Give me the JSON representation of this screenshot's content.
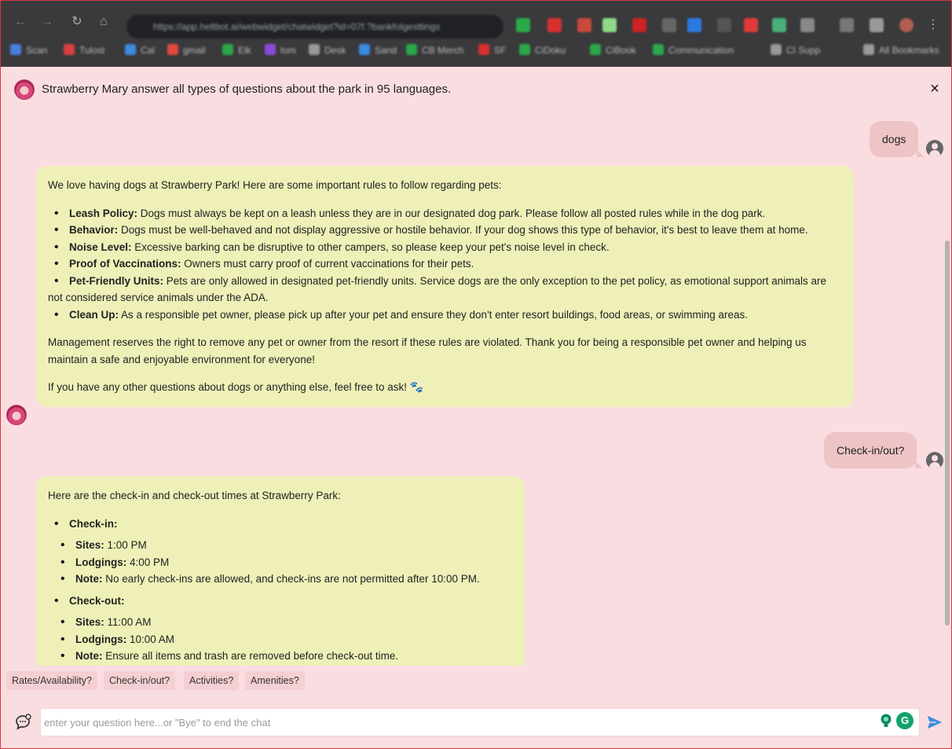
{
  "browser": {
    "url": "https://app.heltbot.ai/webwidget/chatwidget?id=07f.?bankfolgesttings",
    "bookmarks": [
      {
        "label": "Scan",
        "color": "#4a7fe0"
      },
      {
        "label": "Tulost",
        "color": "#d94040"
      },
      {
        "label": "Cal",
        "color": "#3f8ae0"
      },
      {
        "label": "gmail",
        "color": "#e04a3f"
      },
      {
        "label": "Elk",
        "color": "#2aa84a"
      },
      {
        "label": "tom",
        "color": "#8a4ad9"
      },
      {
        "label": "Desk",
        "color": "#999999"
      },
      {
        "label": "Sand",
        "color": "#3a8ae0"
      },
      {
        "label": "CB Merch",
        "color": "#2aa84a"
      },
      {
        "label": "SF",
        "color": "#d93030"
      },
      {
        "label": "CiDoku",
        "color": "#2aa84a"
      },
      {
        "label": "CiBook",
        "color": "#2aa84a"
      },
      {
        "label": "Communication",
        "color": "#2aa84a"
      },
      {
        "label": "CI Supp",
        "color": "#999999"
      },
      {
        "label": "All Bookmarks",
        "color": "#999999"
      }
    ]
  },
  "header": {
    "title": "Strawberry Mary answer all types of questions about the park in 95 languages.",
    "close_label": "×"
  },
  "messages": {
    "user1": "dogs",
    "bot1": {
      "intro": "We love having dogs at Strawberry Park! Here are some important rules to follow regarding pets:",
      "rules": [
        {
          "term": "Leash Policy:",
          "text": " Dogs must always be kept on a leash unless they are in our designated dog park. Please follow all posted rules while in the dog park."
        },
        {
          "term": "Behavior:",
          "text": " Dogs must be well-behaved and not display aggressive or hostile behavior. If your dog shows this type of behavior, it's best to leave them at home."
        },
        {
          "term": "Noise Level:",
          "text": " Excessive barking can be disruptive to other campers, so please keep your pet's noise level in check."
        },
        {
          "term": "Proof of Vaccinations:",
          "text": " Owners must carry proof of current vaccinations for their pets."
        },
        {
          "term": "Pet-Friendly Units:",
          "text": " Pets are only allowed in designated pet-friendly units. Service dogs are the only exception to the pet policy, as emotional support animals are not considered service animals under the ADA."
        },
        {
          "term": "Clean Up:",
          "text": " As a responsible pet owner, please pick up after your pet and ensure they don't enter resort buildings, food areas, or swimming areas."
        }
      ],
      "closing": "Management reserves the right to remove any pet or owner from the resort if these rules are violated. Thank you for being a responsible pet owner and helping us maintain a safe and enjoyable environment for everyone!",
      "followup": "If you have any other questions about dogs or anything else, feel free to ask!",
      "paw": "🐾"
    },
    "user2": "Check-in/out?",
    "bot2": {
      "intro": "Here are the check-in and check-out times at Strawberry Park:",
      "checkin_heading": "Check-in:",
      "checkin": [
        {
          "term": "Sites:",
          "text": " 1:00 PM"
        },
        {
          "term": "Lodgings:",
          "text": " 4:00 PM"
        },
        {
          "term": "Note:",
          "text": " No early check-ins are allowed, and check-ins are not permitted after 10:00 PM."
        }
      ],
      "checkout_heading": "Check-out:",
      "checkout": [
        {
          "term": "Sites:",
          "text": " 11:00 AM"
        },
        {
          "term": "Lodgings:",
          "text": " 10:00 AM"
        },
        {
          "term": "Note:",
          "text": " Ensure all items and trash are removed before check-out time."
        }
      ]
    }
  },
  "quick_replies": [
    "Rates/Availability?",
    "Check-in/out?",
    "Activities?",
    "Amenities?"
  ],
  "input": {
    "placeholder": "enter your question here...or \"Bye\" to end the chat",
    "value": ""
  },
  "colors": {
    "background": "#fadde1",
    "bot_bubble": "#eef0b8",
    "user_bubble": "#eec4c6",
    "send": "#3b8fd9"
  }
}
